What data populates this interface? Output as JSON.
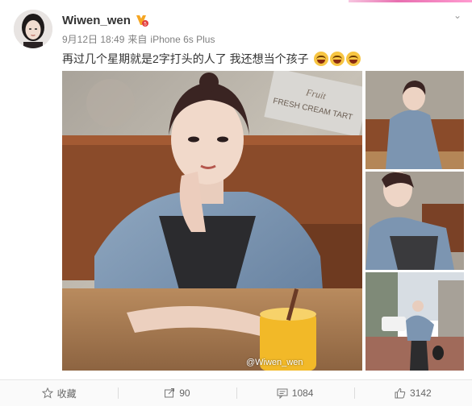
{
  "post": {
    "username": "Wiwen_wen",
    "date": "9月12日 18:49",
    "source_prefix": "来自",
    "source": "iPhone 6s Plus",
    "text": "再过几个星期就是2字打头的人了 我还想当个孩子",
    "emoji_icon": "laughing-tears-emoji",
    "watermark": "@Wiwen_wen",
    "cafe_sign_line1": "Fruit",
    "cafe_sign_line2": "FRESH CREAM TART"
  },
  "actions": {
    "collect_label": "收藏",
    "repost_count": "90",
    "comment_count": "1084",
    "like_count": "3142"
  },
  "colors": {
    "accent": "#e86fb0",
    "text": "#333333",
    "meta": "#808080",
    "badge": "#f5a623"
  }
}
